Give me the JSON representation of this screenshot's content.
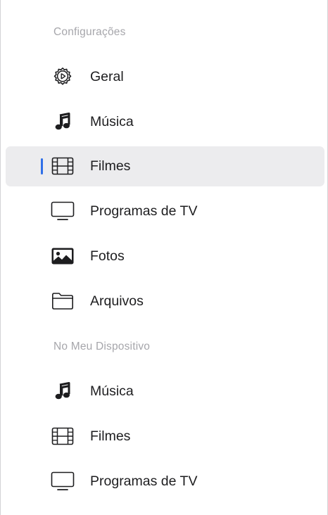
{
  "sidebar": {
    "sections": [
      {
        "header": "Configurações",
        "items": [
          {
            "label": "Geral",
            "icon": "gear-icon"
          },
          {
            "label": "Música",
            "icon": "music-note-icon"
          },
          {
            "label": "Filmes",
            "icon": "film-icon",
            "selected": true
          },
          {
            "label": "Programas de TV",
            "icon": "tv-icon"
          },
          {
            "label": "Fotos",
            "icon": "photo-icon"
          },
          {
            "label": "Arquivos",
            "icon": "folder-icon"
          }
        ]
      },
      {
        "header": "No Meu Dispositivo",
        "items": [
          {
            "label": "Música",
            "icon": "music-note-icon"
          },
          {
            "label": "Filmes",
            "icon": "film-icon"
          },
          {
            "label": "Programas de TV",
            "icon": "tv-icon"
          }
        ]
      }
    ]
  },
  "colors": {
    "accent": "#2f6fe8",
    "selected_background": "#ececee",
    "header_text": "#a6a6ab",
    "item_text": "#1d1d1f"
  }
}
